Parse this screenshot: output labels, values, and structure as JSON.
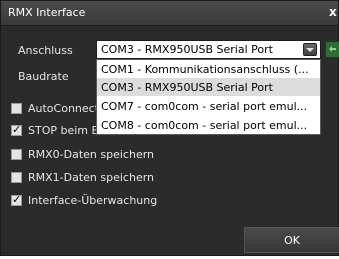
{
  "window": {
    "title": "RMX Interface",
    "close_label": "x"
  },
  "form": {
    "anschluss_label": "Anschluss",
    "baudrate_label": "Baudrate",
    "combo": {
      "selected": "COM3 - RMX950USB Serial Port",
      "options": [
        "COM1 -  Kommunikationsanschluss (...",
        "COM3 - RMX950USB Serial Port",
        "COM7 - com0com - serial port emul...",
        "COM8 - com0com - serial port emul..."
      ],
      "highlighted_index": 1
    }
  },
  "checkboxes": [
    {
      "label": "AutoConnect",
      "checked": false
    },
    {
      "label": "STOP beim Beenden",
      "checked": true
    },
    {
      "label": "RMX0-Daten speichern",
      "checked": false
    },
    {
      "label": "RMX1-Daten speichern",
      "checked": false
    },
    {
      "label": "Interface-Überwachung",
      "checked": true
    }
  ],
  "buttons": {
    "ok_label": "OK"
  },
  "colors": {
    "window_bg": "#2b2b2b",
    "text": "#e6e6e6",
    "refresh_accent": "#2f6b35"
  }
}
